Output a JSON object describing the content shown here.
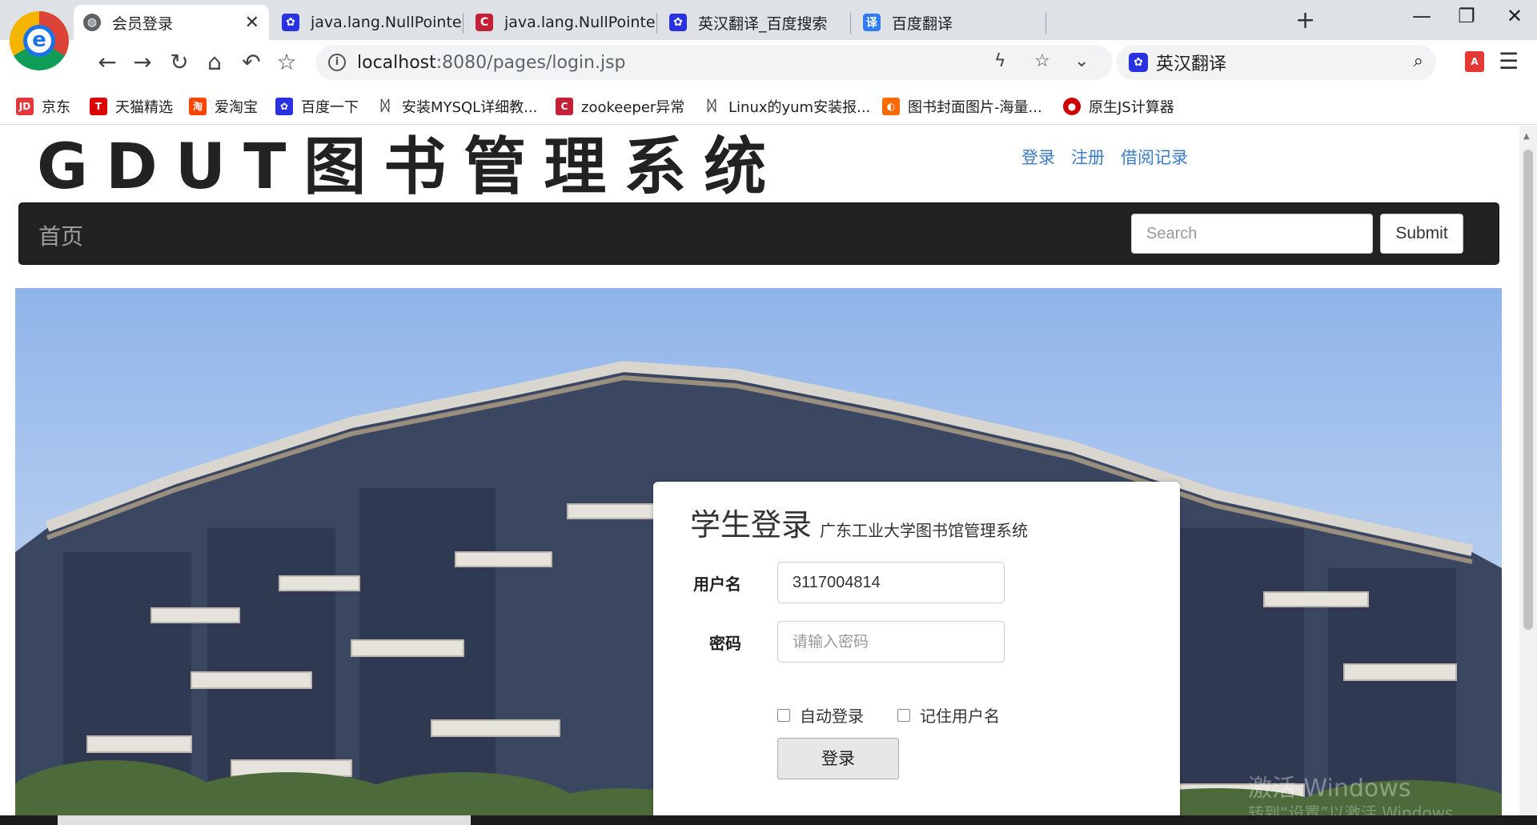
{
  "browser": {
    "tabs": [
      {
        "title": "会员登录",
        "active": true,
        "icon": "globe-icon"
      },
      {
        "title": "java.lang.NullPointerExcept",
        "icon": "baidu-paw-icon"
      },
      {
        "title": "java.lang.NullPointerExcep",
        "icon": "csdn-icon"
      },
      {
        "title": "英汉翻译_百度搜索",
        "icon": "baidu-paw-icon"
      },
      {
        "title": "百度翻译",
        "icon": "baidu-translate-icon"
      }
    ],
    "address": {
      "host": "localhost",
      "rest": ":8080/pages/login.jsp"
    },
    "search_engine_text": "英汉翻译",
    "bookmarks": [
      {
        "label": "京东",
        "icon_text": "JD",
        "color": "#e4393c"
      },
      {
        "label": "天猫精选",
        "icon_text": "T",
        "color": "#d00"
      },
      {
        "label": "爱淘宝",
        "icon_text": "淘",
        "color": "#ff4400"
      },
      {
        "label": "百度一下",
        "icon_text": "",
        "color": "#2932e1"
      },
      {
        "label": "安装MYSQL详细教...",
        "icon_text": "",
        "color": "#555"
      },
      {
        "label": "zookeeper异常",
        "icon_text": "C",
        "color": "#c32136"
      },
      {
        "label": "Linux的yum安装报...",
        "icon_text": "",
        "color": "#555"
      },
      {
        "label": "图书封面图片-海量...",
        "icon_text": "",
        "color": "#ff6a00"
      },
      {
        "label": "原生JS计算器",
        "icon_text": "",
        "color": "#c00"
      }
    ]
  },
  "site": {
    "title": "GDUT图书管理系统",
    "top_links": [
      "登录",
      "注册",
      "借阅记录"
    ],
    "nav": {
      "brand": "首页",
      "search_placeholder": "Search",
      "submit_label": "Submit"
    }
  },
  "login": {
    "title": "学生登录",
    "subtitle": "广东工业大学图书馆管理系统",
    "username_label": "用户名",
    "username_value": "3117004814",
    "password_label": "密码",
    "password_placeholder": "请输入密码",
    "auto_login_label": "自动登录",
    "remember_label": "记住用户名",
    "submit_label": "登录"
  },
  "watermark": {
    "line1": "激活 Windows",
    "line2": "转到“设置”以激活 Windows。"
  },
  "colors": {
    "link": "#3a7cc7",
    "navbar": "#222222",
    "sky": "#9dbcea",
    "building": "#3b4761"
  }
}
